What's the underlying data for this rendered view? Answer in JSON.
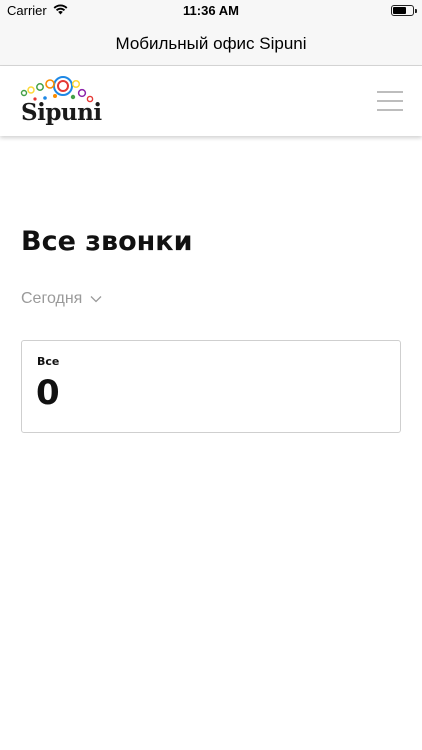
{
  "status_bar": {
    "carrier": "Carrier",
    "time": "11:36 AM",
    "icons": [
      "wifi-icon",
      "battery-icon"
    ]
  },
  "nav_bar": {
    "title": "Мобильный офис Sipuni"
  },
  "header": {
    "logo_text": "Sipuni",
    "menu_icon": "hamburger-menu-icon",
    "logo_colors": [
      "#e53935",
      "#fb8c00",
      "#fdd835",
      "#43a047",
      "#1e88e5",
      "#8e24aa"
    ]
  },
  "main": {
    "title": "Все звонки",
    "period": {
      "selected": "Сегодня",
      "icon": "chevron-down-icon"
    },
    "stats": [
      {
        "label": "Все",
        "value": "0"
      }
    ]
  }
}
